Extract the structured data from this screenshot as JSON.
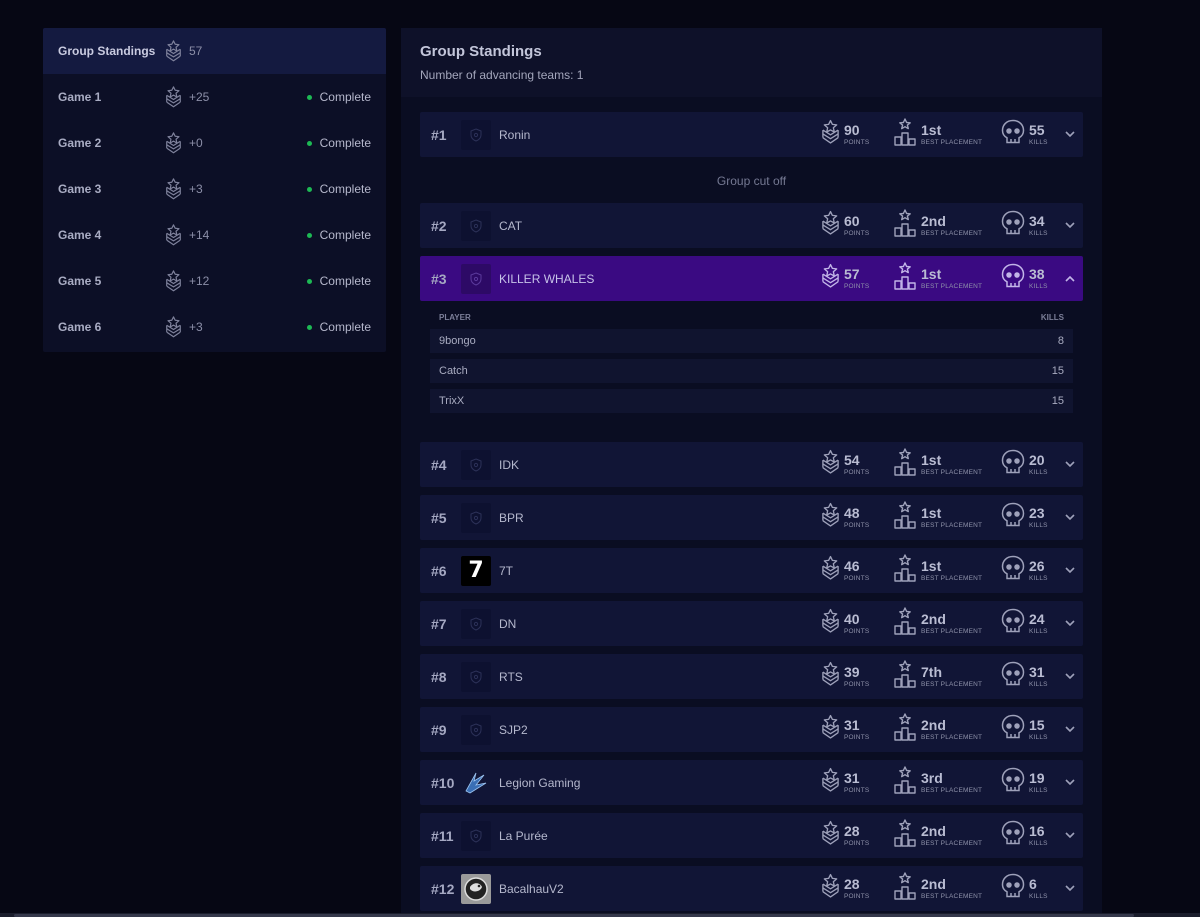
{
  "nav": {
    "items": [
      {
        "label": "Group Standings",
        "points": "57",
        "status": "",
        "active": true
      },
      {
        "label": "Game 1",
        "points": "+25",
        "status": "Complete"
      },
      {
        "label": "Game 2",
        "points": "+0",
        "status": "Complete"
      },
      {
        "label": "Game 3",
        "points": "+3",
        "status": "Complete"
      },
      {
        "label": "Game 4",
        "points": "+14",
        "status": "Complete"
      },
      {
        "label": "Game 5",
        "points": "+12",
        "status": "Complete"
      },
      {
        "label": "Game 6",
        "points": "+3",
        "status": "Complete"
      }
    ]
  },
  "panel": {
    "title": "Group Standings",
    "subtitle": "Number of advancing teams: 1",
    "cutoff_label": "Group cut off"
  },
  "stat_labels": {
    "points": "POINTS",
    "placement": "BEST PLACEMENT",
    "kills": "KILLS"
  },
  "teams": [
    {
      "rank": "#1",
      "name": "Ronin",
      "points": "90",
      "placement": "1st",
      "kills": "55",
      "logo": "shield-placeholder"
    },
    {
      "rank": "#2",
      "name": "CAT",
      "points": "60",
      "placement": "2nd",
      "kills": "34",
      "logo": "shield-placeholder"
    },
    {
      "rank": "#3",
      "name": "KILLER WHALES",
      "points": "57",
      "placement": "1st",
      "kills": "38",
      "logo": "shield-placeholder",
      "expanded": true
    },
    {
      "rank": "#4",
      "name": "IDK",
      "points": "54",
      "placement": "1st",
      "kills": "20",
      "logo": "shield-placeholder"
    },
    {
      "rank": "#5",
      "name": "BPR",
      "points": "48",
      "placement": "1st",
      "kills": "23",
      "logo": "shield-placeholder"
    },
    {
      "rank": "#6",
      "name": "7T",
      "points": "46",
      "placement": "1st",
      "kills": "26",
      "logo": "seven-logo",
      "logo_text": "7"
    },
    {
      "rank": "#7",
      "name": "DN",
      "points": "40",
      "placement": "2nd",
      "kills": "24",
      "logo": "shield-placeholder"
    },
    {
      "rank": "#8",
      "name": "RTS",
      "points": "39",
      "placement": "7th",
      "kills": "31",
      "logo": "shield-placeholder"
    },
    {
      "rank": "#9",
      "name": "SJP2",
      "points": "31",
      "placement": "2nd",
      "kills": "15",
      "logo": "shield-placeholder"
    },
    {
      "rank": "#10",
      "name": "Legion Gaming",
      "points": "31",
      "placement": "3rd",
      "kills": "19",
      "logo": "legion-logo"
    },
    {
      "rank": "#11",
      "name": "La Purée",
      "points": "28",
      "placement": "2nd",
      "kills": "16",
      "logo": "shield-placeholder"
    },
    {
      "rank": "#12",
      "name": "BacalhauV2",
      "points": "28",
      "placement": "2nd",
      "kills": "6",
      "logo": "bacalhau-logo"
    }
  ],
  "expanded_players": {
    "header_player": "PLAYER",
    "header_kills": "KILLS",
    "rows": [
      {
        "player": "9bongo",
        "kills": "8"
      },
      {
        "player": "Catch",
        "kills": "15"
      },
      {
        "player": "TrixX",
        "kills": "15"
      }
    ]
  },
  "colors": {
    "background": "#060714",
    "panel": "#0a0d22",
    "row": "#111536",
    "expanded_row": "#3a0a82",
    "status_dot": "#1db954"
  }
}
